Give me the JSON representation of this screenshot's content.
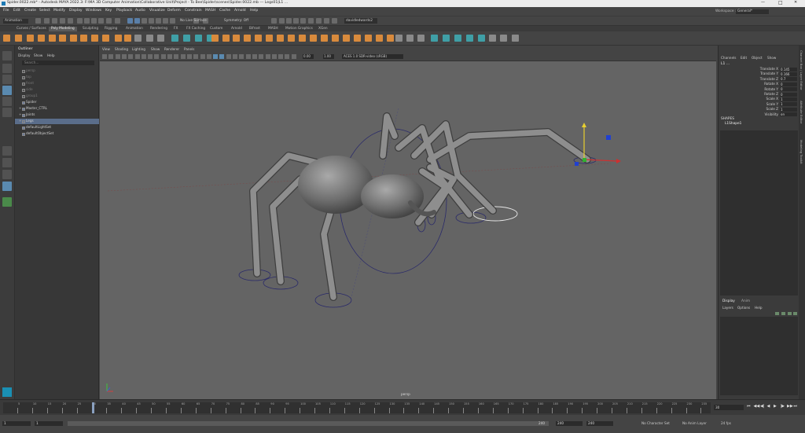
{
  "titlebar": {
    "title": "Spider.0022.mb* - Autodesk MAYA 2022.3: F:\\MA 3D Computer Animation\\Collaborative Unit\\Project - To Bee\\Spider\\scenes\\Spider.0022.mb  ---  Legs01|L1 ...",
    "minimize": "—",
    "maximize": "□",
    "close": "✕"
  },
  "menubar": {
    "items": [
      "File",
      "Edit",
      "Create",
      "Select",
      "Modify",
      "Display",
      "Windows",
      "Key",
      "Playback",
      "Audio",
      "Visualize",
      "Deform",
      "Constrain",
      "MASH",
      "Cache",
      "Arnold",
      "Help"
    ],
    "workspace_label": "Workspace :",
    "workspace_value": "General*"
  },
  "statusline": {
    "mode": "Animation",
    "live_surface": "No Live Surface",
    "symmetry": "Symmetry: Off",
    "user": "davidledwards2"
  },
  "shelf": {
    "tabs": [
      "Curves / Surfaces",
      "Poly Modeling",
      "Sculpting",
      "Rigging",
      "Animation",
      "Rendering",
      "FX",
      "FX Caching",
      "Custom",
      "Arnold",
      "Bifrost",
      "MASH",
      "Motion Graphics",
      "XGen"
    ],
    "active_tab": "Poly Modeling"
  },
  "outliner": {
    "title": "Outliner",
    "menu": [
      "Display",
      "Show",
      "Help"
    ],
    "search_placeholder": "Search...",
    "items": [
      {
        "label": "persp",
        "dim": true,
        "expand": false
      },
      {
        "label": "top",
        "dim": true,
        "expand": false
      },
      {
        "label": "front",
        "dim": true,
        "expand": false
      },
      {
        "label": "side",
        "dim": true,
        "expand": false
      },
      {
        "label": "group1",
        "dim": true,
        "expand": false
      },
      {
        "label": "Spider",
        "dim": false,
        "expand": false
      },
      {
        "label": "Master_CTRL",
        "dim": false,
        "expand": true
      },
      {
        "label": "Joints",
        "dim": false,
        "expand": true
      },
      {
        "label": "Legs",
        "dim": false,
        "expand": true,
        "selected": true
      },
      {
        "label": "defaultLightSet",
        "dim": false,
        "expand": false
      },
      {
        "label": "defaultObjectSet",
        "dim": false,
        "expand": false
      }
    ]
  },
  "viewport": {
    "menu": [
      "View",
      "Shading",
      "Lighting",
      "Show",
      "Renderer",
      "Panels"
    ],
    "near_value": "0.00",
    "far_value": "1.00",
    "colorspace": "ACES 1.0 SDR-video (sRGB)",
    "camera_label": "persp"
  },
  "channelbox": {
    "menu": [
      "Channels",
      "Edit",
      "Object",
      "Show"
    ],
    "object_name": "L1 ...",
    "attributes": [
      {
        "name": "Translate X",
        "value": "0.145"
      },
      {
        "name": "Translate Y",
        "value": "0.166"
      },
      {
        "name": "Translate Z",
        "value": "0.7"
      },
      {
        "name": "Rotate X",
        "value": "0"
      },
      {
        "name": "Rotate Y",
        "value": "0"
      },
      {
        "name": "Rotate Z",
        "value": "0"
      },
      {
        "name": "Scale X",
        "value": "1"
      },
      {
        "name": "Scale Y",
        "value": "1"
      },
      {
        "name": "Scale Z",
        "value": "1"
      },
      {
        "name": "Visibility",
        "value": "on"
      }
    ],
    "shapes_header": "SHAPES",
    "shape_name": "L1Shape1",
    "layer_tabs": [
      "Display",
      "Anim"
    ],
    "layer_menu": [
      "Layers",
      "Options",
      "Help"
    ]
  },
  "sidetabs": [
    "Channel Box / Layer Editor",
    "Attribute Editor",
    "Modeling Toolkit"
  ],
  "timeline": {
    "ticks": [
      "5",
      "10",
      "15",
      "20",
      "25",
      "30",
      "35",
      "40",
      "45",
      "50",
      "55",
      "60",
      "65",
      "70",
      "75",
      "80",
      "85",
      "90",
      "95",
      "100",
      "105",
      "110",
      "115",
      "120",
      "125",
      "130",
      "135",
      "140",
      "145",
      "150",
      "155",
      "160",
      "165",
      "170",
      "175",
      "180",
      "185",
      "190",
      "195",
      "200",
      "205",
      "210",
      "215",
      "220",
      "225",
      "230",
      "235"
    ],
    "current_frame": "30"
  },
  "range": {
    "start": "1",
    "start_inner": "1",
    "end_inner": "240",
    "end": "240",
    "end_outer": "240",
    "character_set": "No Character Set",
    "anim_layer": "No Anim Layer",
    "fps": "24 fps"
  },
  "colors": {
    "accent_orange": "#d88a3c",
    "accent_teal": "#3f9fa6",
    "selection_blue": "#5a6d8a",
    "viewport_bg": "#646464"
  }
}
